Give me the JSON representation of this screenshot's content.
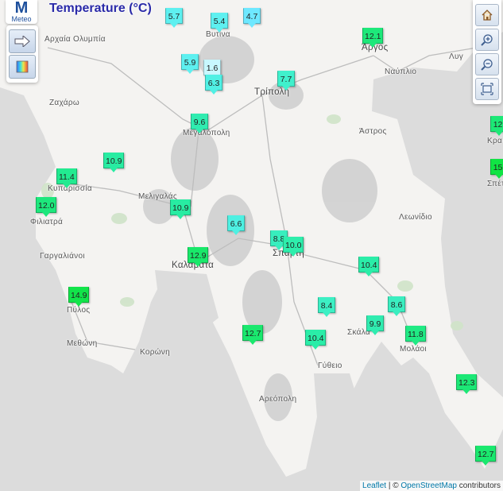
{
  "header": {
    "logo_letter": "M",
    "logo_text": "Meteo",
    "title": "Temperature (°C)"
  },
  "controls": {
    "left": [
      {
        "icon": "arrow-right-icon"
      },
      {
        "icon": "color-scale-icon"
      }
    ],
    "right": [
      {
        "icon": "home-icon"
      },
      {
        "icon": "zoom-in-icon"
      },
      {
        "icon": "zoom-out-icon"
      },
      {
        "icon": "fullscreen-icon"
      }
    ]
  },
  "places": [
    {
      "name": "Αρχαία Ολυμπία"
    },
    {
      "name": "Βυτίνα"
    },
    {
      "name": "Άργος"
    },
    {
      "name": "Λυγ"
    },
    {
      "name": "Ναύπλιο"
    },
    {
      "name": "Τρίπολη"
    },
    {
      "name": "Ζαχάρω"
    },
    {
      "name": "Μεγαλόπολη"
    },
    {
      "name": "Άστρος"
    },
    {
      "name": "Κυπαρισσία"
    },
    {
      "name": "Μελιγαλάς"
    },
    {
      "name": "Φιλιατρά"
    },
    {
      "name": "Λεωνίδιο"
    },
    {
      "name": "Σπάρτη"
    },
    {
      "name": "Γαργαλιάνοι"
    },
    {
      "name": "Καλαμάτα"
    },
    {
      "name": "Πύλος"
    },
    {
      "name": "Σκάλα"
    },
    {
      "name": "Μεθώνη"
    },
    {
      "name": "Κορώνη"
    },
    {
      "name": "Μολάοι"
    },
    {
      "name": "Γύθειο"
    },
    {
      "name": "Αρεόπολη"
    },
    {
      "name": "Κρα"
    },
    {
      "name": "Σπέτ"
    }
  ],
  "stations": [
    {
      "temp": "5.7",
      "color": "#5ef0f0"
    },
    {
      "temp": "5.4",
      "color": "#5ef0f0"
    },
    {
      "temp": "4.7",
      "color": "#6ee8ff"
    },
    {
      "temp": "12.1",
      "color": "#1de87a"
    },
    {
      "temp": "5.9",
      "color": "#5ef0f0"
    },
    {
      "temp": "1.6",
      "color": "#c8f8ff"
    },
    {
      "temp": "6.3",
      "color": "#50f0e4"
    },
    {
      "temp": "7.7",
      "color": "#40f0cc"
    },
    {
      "temp": "9.6",
      "color": "#30ecb0"
    },
    {
      "temp": "10.9",
      "color": "#28eca2"
    },
    {
      "temp": "11.4",
      "color": "#22ea90"
    },
    {
      "temp": "12.0",
      "color": "#1de87c"
    },
    {
      "temp": "10.9",
      "color": "#28eca2"
    },
    {
      "temp": "6.6",
      "color": "#4ef0e2"
    },
    {
      "temp": "8.8",
      "color": "#38eebe"
    },
    {
      "temp": "10.0",
      "color": "#2eeeac"
    },
    {
      "temp": "12.9",
      "color": "#19e86a"
    },
    {
      "temp": "10.4",
      "color": "#2aeda8"
    },
    {
      "temp": "14.9",
      "color": "#12e44a"
    },
    {
      "temp": "8.4",
      "color": "#3cf0c4"
    },
    {
      "temp": "8.6",
      "color": "#3aeec0"
    },
    {
      "temp": "9.9",
      "color": "#30ecb0"
    },
    {
      "temp": "12.7",
      "color": "#1ae86e"
    },
    {
      "temp": "10.4",
      "color": "#2aeda8"
    },
    {
      "temp": "11.8",
      "color": "#20ea84"
    },
    {
      "temp": "12.3",
      "color": "#1ce876"
    },
    {
      "temp": "12.7",
      "color": "#1ae86e"
    },
    {
      "temp": "12.",
      "color": "#1ce876"
    },
    {
      "temp": "15.",
      "color": "#10e444"
    }
  ],
  "attribution": {
    "leaflet": "Leaflet",
    "sep": " | © ",
    "osm": "OpenStreetMap",
    "suffix": " contributors"
  }
}
